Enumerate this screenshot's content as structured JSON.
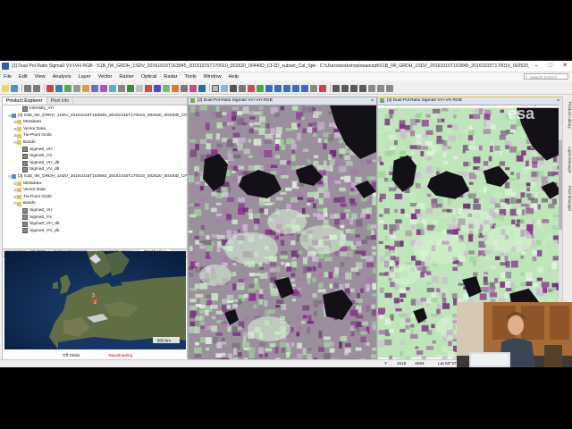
{
  "window": {
    "title": "[3] Dual Pol Ratio Sigma0 VV+VH RGB - S1B_IW_GRDH_1SDV_20161015T163945_20161015T170010_002520_00440D_CF2D_subset_Cal_Spk - C:\\Users\\workshop\\esaoutpt\\S1B_IW_GRDH_1SDV_20161015T163945_20161015T170010_002520_00440D_CF2D_subset_Cal_Spk",
    "minimize": "–",
    "maximize": "□",
    "close": "✕"
  },
  "menu": [
    "File",
    "Edit",
    "View",
    "Analysis",
    "Layer",
    "Vector",
    "Raster",
    "Optical",
    "Radar",
    "Tools",
    "Window",
    "Help"
  ],
  "search": {
    "placeholder": "Search (Ctrl+I)"
  },
  "left_panel": {
    "tabs": [
      "Product Explorer",
      "Pixel Info"
    ],
    "tree": [
      {
        "indent": 3,
        "label": "Intensity_VH",
        "icon": "band"
      },
      {
        "indent": 1,
        "label": "[2] S1B_IW_GRDH_1SDV_20161015T163945_20161015T170010_002520_00440D_CF2D_c",
        "icon": "prod",
        "toggle": "⊟"
      },
      {
        "indent": 2,
        "label": "Metadata",
        "icon": "folder",
        "toggle": "⊞"
      },
      {
        "indent": 2,
        "label": "Vector Data",
        "icon": "folder",
        "toggle": "⊞"
      },
      {
        "indent": 2,
        "label": "Tie-Point Grids",
        "icon": "folder",
        "toggle": "⊞"
      },
      {
        "indent": 2,
        "label": "Bands",
        "icon": "folder",
        "toggle": "⊟"
      },
      {
        "indent": 3,
        "label": "Sigma0_VH",
        "icon": "band"
      },
      {
        "indent": 3,
        "label": "Sigma0_VV",
        "icon": "band"
      },
      {
        "indent": 3,
        "label": "Sigma0_VH_db",
        "icon": "band"
      },
      {
        "indent": 3,
        "label": "Sigma0_VV_db",
        "icon": "band"
      },
      {
        "indent": 1,
        "label": "[3] S1B_IW_GRDH_1SDV_20161015T163945_20161015T170010_002520_00440D_CF2D_c",
        "icon": "prod",
        "toggle": "⊟"
      },
      {
        "indent": 2,
        "label": "Metadata",
        "icon": "folder",
        "toggle": "⊞"
      },
      {
        "indent": 2,
        "label": "Vector Data",
        "icon": "folder",
        "toggle": "⊞"
      },
      {
        "indent": 2,
        "label": "Tie-Point Grids",
        "icon": "folder",
        "toggle": "⊞"
      },
      {
        "indent": 2,
        "label": "Bands",
        "icon": "folder",
        "toggle": "⊟"
      },
      {
        "indent": 3,
        "label": "Sigma0_VH",
        "icon": "band"
      },
      {
        "indent": 3,
        "label": "Sigma0_VV",
        "icon": "band"
      },
      {
        "indent": 3,
        "label": "Sigma0_VH_db",
        "icon": "band"
      },
      {
        "indent": 3,
        "label": "Sigma0_VV_db",
        "icon": "band"
      }
    ],
    "nav_tabs": [
      "Navigation - [3] RGB",
      "Colour Manipulati...",
      "Uncertainty Visua...",
      "World View"
    ],
    "world_view": {
      "scale_label": "500 km",
      "globe_mode": "Off Globe",
      "status": "Downloading",
      "markers": [
        "3",
        "2"
      ]
    }
  },
  "views": {
    "left_tab": "[2] Dual Pol Ratio Sigma0 VV+VH RGB",
    "right_tab": "[3] Dual Pol Ratio Sigma0 VV+VH RGB"
  },
  "right_dock": [
    "Product Library",
    "Layer Manager",
    "Pixel Manager"
  ],
  "status": {
    "x": "3118",
    "y": "4694",
    "lat": "Lat 53°37'",
    "zoom": "Y"
  },
  "watermark": "esa",
  "colors": {
    "field_purple": "#8b2f8e",
    "field_green": "#b8e3b5",
    "water": "#141018",
    "selection_border": "#e4c24a"
  }
}
